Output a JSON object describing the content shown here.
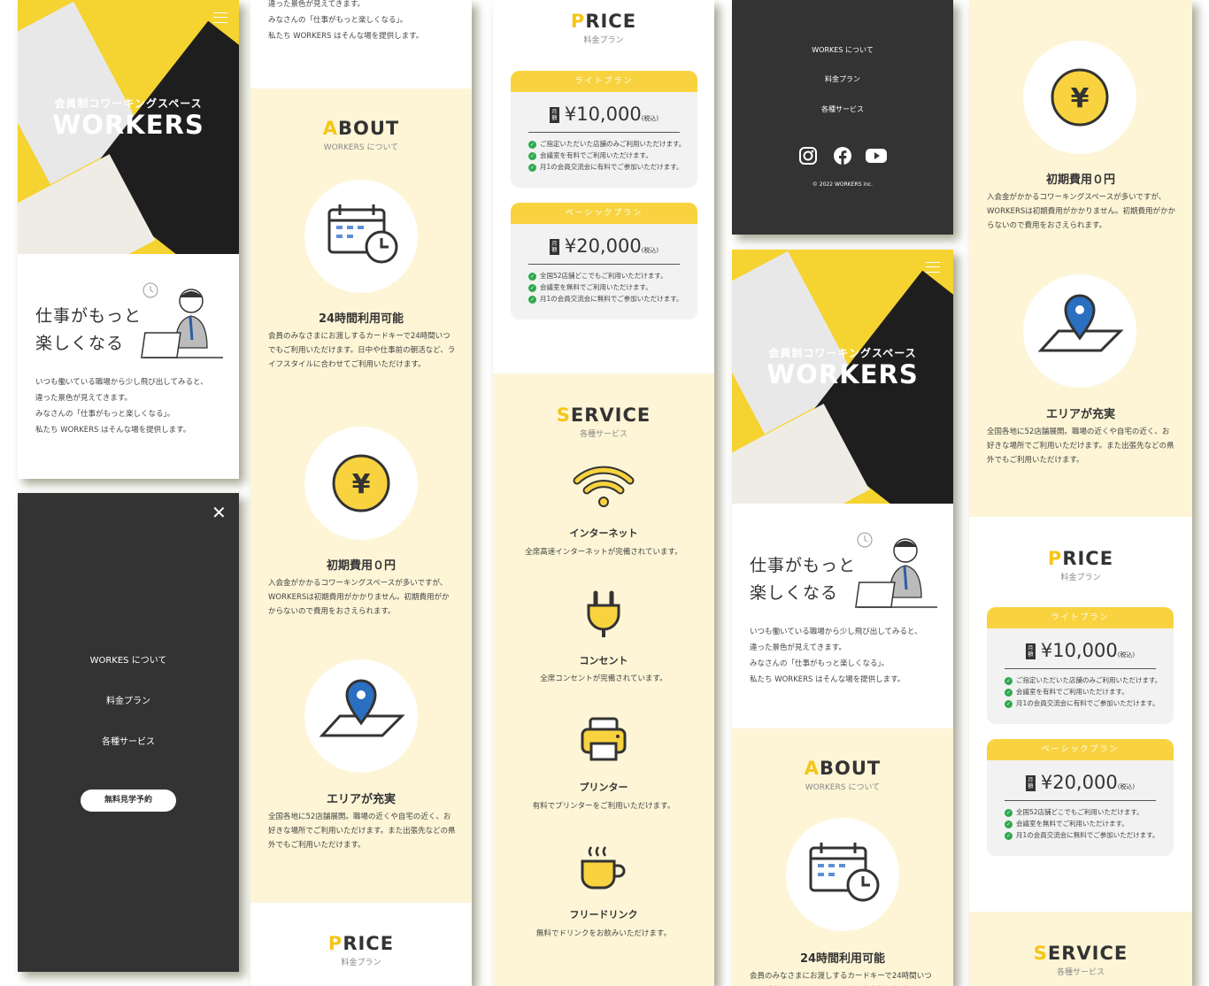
{
  "colors": {
    "accent": "#f8d33f",
    "dark": "#333333",
    "pale": "#fdf5d6"
  },
  "hero": {
    "subtitle": "会員制コワーキングスペース",
    "title": "WORKERS"
  },
  "lead": {
    "line1": "仕事がもっと",
    "line2": "楽しくなる"
  },
  "intro": {
    "l1": "いつも働いている職場から少し飛び出してみると、",
    "l2": "違った景色が見えてきます。",
    "l3": "みなさんの「仕事がもっと楽しくなる」。",
    "l4": "私たち WORKERS はそんな場を提供します。"
  },
  "about": {
    "first": "A",
    "rest": "BOUT",
    "sub": "WORKERS について"
  },
  "features": [
    {
      "title": "24時間利用可能",
      "text": "会員のみなさまにお渡しするカードキーで24時間いつでもご利用いただけます。日中や仕事前の朝活など、ライフスタイルに合わせてご利用いただけます。",
      "icon": "calendar-clock-icon"
    },
    {
      "title": "初期費用０円",
      "text": "入会金がかかるコワーキングスペースが多いですが、WORKERSは初期費用がかかりません。初期費用がかからないので費用をおさえられます。",
      "icon": "yen-coin-icon"
    },
    {
      "title": "エリアが充実",
      "text": "全国各地に52店舗展開。職場の近くや自宅の近く、お好きな場所でご利用いただけます。また出張先などの県外でもご利用いただけます。",
      "icon": "map-pin-icon"
    }
  ],
  "price": {
    "first": "P",
    "rest": "RICE",
    "sub": "料金プラン",
    "month": "月額",
    "tax": "(税込)",
    "plans": [
      {
        "name": "ライトプラン",
        "amount": "¥10,000",
        "items": [
          "ご指定いただいた店舗のみご利用いただけます。",
          "会議室を有料でご利用いただけます。",
          "月1の会員交流会に有料でご参加いただけます。"
        ]
      },
      {
        "name": "ベーシックプラン",
        "amount": "¥20,000",
        "items": [
          "全国52店舗どこでもご利用いただけます。",
          "会議室を無料でご利用いただけます。",
          "月1の会員交流会に無料でご参加いただけます。"
        ]
      }
    ]
  },
  "service": {
    "first": "S",
    "rest": "ERVICE",
    "sub": "各種サービス",
    "items": [
      {
        "title": "インターネット",
        "text": "全席高速インターネットが完備されています。",
        "icon": "wifi-icon"
      },
      {
        "title": "コンセント",
        "text": "全席コンセントが完備されています。",
        "icon": "plug-icon"
      },
      {
        "title": "プリンター",
        "text": "有料でプリンターをご利用いただけます。",
        "icon": "printer-icon"
      },
      {
        "title": "フリードリンク",
        "text": "無料でドリンクをお飲みいただけます。",
        "icon": "coffee-icon"
      }
    ]
  },
  "menu": {
    "about": "WORKES について",
    "price": "料金プラン",
    "service": "各種サービス",
    "cta": "無料見学予約"
  },
  "footer": {
    "copyright": "© 2022 WORKERS inc."
  }
}
